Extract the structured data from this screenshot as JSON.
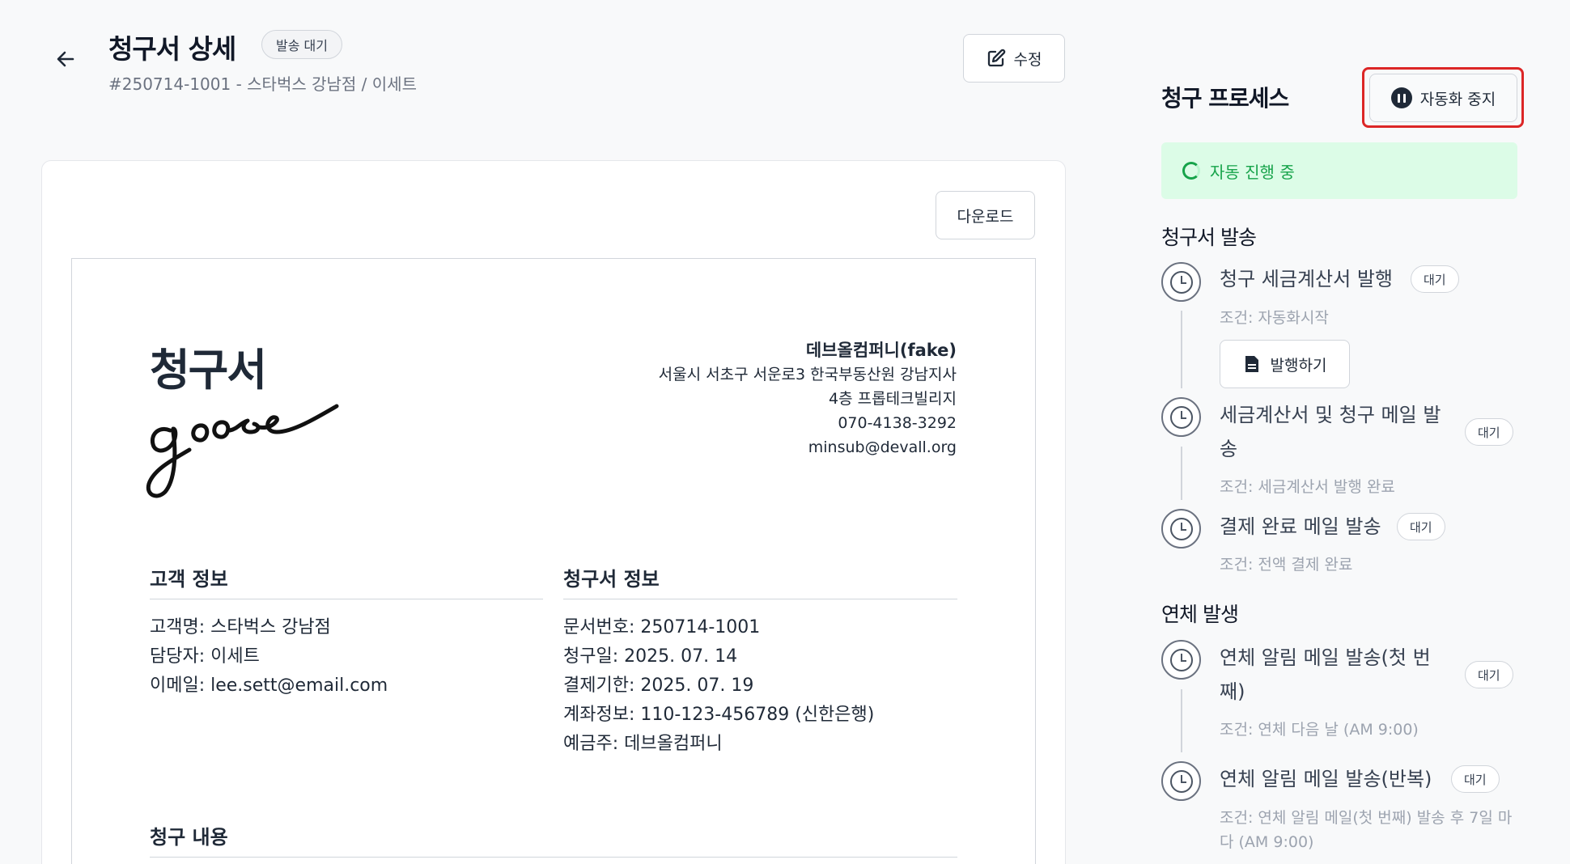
{
  "header": {
    "title": "청구서 상세",
    "status": "발송 대기",
    "subtitle": "#250714-1001 - 스타벅스 강남점 / 이세트",
    "edit_label": "수정"
  },
  "document": {
    "download_label": "다운로드",
    "heading": "청구서",
    "signature": "goose",
    "company": {
      "name": "데브올컴퍼니(fake)",
      "address1": "서울시 서초구 서운로3 한국부동산원 강남지사",
      "address2": "4층 프롭테크빌리지",
      "phone": "070-4138-3292",
      "email": "minsub@devall.org"
    },
    "customer_section": {
      "title": "고객 정보",
      "lines": [
        "고객명: 스타벅스 강남점",
        "담당자: 이세트",
        "이메일: lee.sett@email.com"
      ]
    },
    "invoice_section": {
      "title": "청구서 정보",
      "lines": [
        "문서번호: 250714-1001",
        "청구일: 2025. 07. 14",
        "결제기한: 2025. 07. 19",
        "계좌정보: 110-123-456789 (신한은행)",
        "예금주: 데브올컴퍼니"
      ]
    },
    "items_section": {
      "title": "청구 내용"
    }
  },
  "process": {
    "title": "청구 프로세스",
    "pause_label": "자동화 중지",
    "auto_status": "자동 진행 중",
    "groups": [
      {
        "title": "청구서 발송",
        "steps": [
          {
            "label": "청구 세금계산서 발행",
            "badge": "대기",
            "condition": "조건: 자동화시작",
            "action": "발행하기"
          },
          {
            "label_line1": "세금계산서 및 청구 메일 발",
            "label_line2": "송",
            "badge": "대기",
            "condition": "조건: 세금계산서 발행 완료"
          },
          {
            "label": "결제 완료 메일 발송",
            "badge": "대기",
            "condition": "조건: 전액 결제 완료"
          }
        ]
      },
      {
        "title": "연체 발생",
        "steps": [
          {
            "label_line1": "연체 알림 메일 발송(첫 번",
            "label_line2": "째)",
            "badge": "대기",
            "condition": "조건: 연체 다음 날 (AM 9:00)"
          },
          {
            "label": "연체 알림 메일 발송(반복)",
            "badge": "대기",
            "condition_line1": "조건: 연체 알림 메일(첫 번째) 발송 후 7일 마",
            "condition_line2": "다 (AM 9:00)"
          }
        ]
      }
    ]
  },
  "colors": {
    "highlight": "#dc2626",
    "auto_status_bg": "#dcfce7",
    "auto_status_text": "#16a34a"
  },
  "icons": [
    "arrow-left-icon",
    "edit-icon",
    "pause-icon",
    "spinner-icon",
    "clock-icon",
    "document-icon"
  ]
}
